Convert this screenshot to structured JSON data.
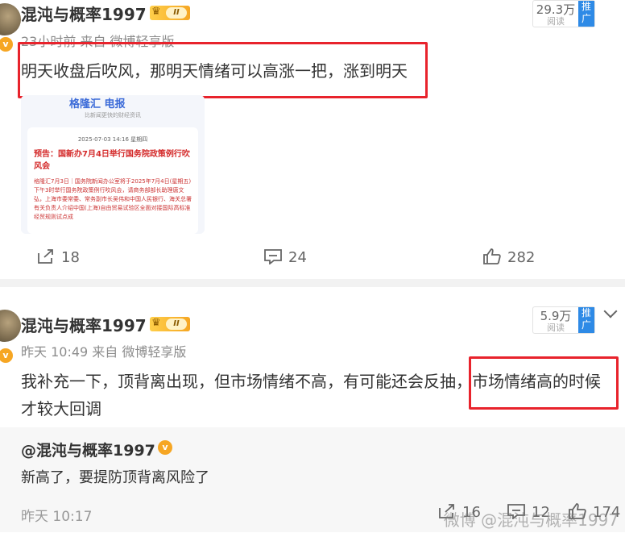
{
  "post1": {
    "username": "混沌与概率1997",
    "level_badge": "II",
    "meta": "23小时前  来自 微博轻享版",
    "content": "明天收盘后吹风，那明天情绪可以高涨一把，涨到明天",
    "reads": {
      "count": "29.3万",
      "label": "阅读",
      "push": "推广"
    },
    "image": {
      "header": "格隆汇 电报",
      "subheader": "比新闻更快的财经资讯",
      "date": "2025-07-03 14:16 星期四",
      "title": "预告：国新办7月4日举行国务院政策例行吹风会",
      "body": "格隆汇7月3日｜国务院新闻办公室将于2025年7月4日(星期五)下午3时举行国务院政策例行吹风会，请商务部部长助理唐文弘，上海市委常委、常务副市长吴伟和中国人民银行、海关总署有关负责人介绍中国(上海)自由贸易试验区全面对接国际高标准经贸规则试点成"
    },
    "actions": {
      "share": "18",
      "comment": "24",
      "like": "282"
    }
  },
  "post2": {
    "username": "混沌与概率1997",
    "level_badge": "II",
    "meta": "昨天 10:49  来自 微博轻享版",
    "content_line1": "我补充一下，顶背离出现，但市场情绪不高，有可能还会反抽，市场情绪高的时候",
    "content_line2": "才较大回调",
    "reads": {
      "count": "5.9万",
      "label": "阅读",
      "push": "推广"
    },
    "quote": {
      "username": "@混沌与概率1997",
      "text": "新高了，要提防顶背离风险了",
      "time": "昨天 10:17",
      "actions": {
        "share": "16",
        "comment": "12",
        "like": "174"
      }
    }
  },
  "watermark": "微博 @混沌与概率1997",
  "colors": {
    "highlight": "#e8232c",
    "push": "#2e8ae6",
    "vip": "#f6a623"
  }
}
